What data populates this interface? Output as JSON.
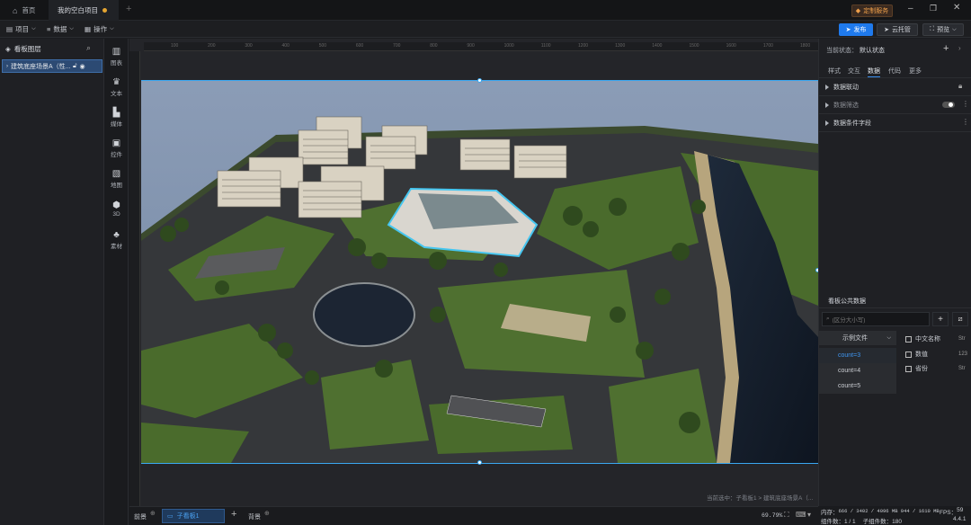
{
  "tabs": [
    {
      "label": "首页"
    },
    {
      "label": "我的空白项目"
    }
  ],
  "topRight": {
    "customize": "定制服务"
  },
  "menu": {
    "project": "项目",
    "data": "数据",
    "operate": "操作"
  },
  "actions": {
    "publish": "发布",
    "hosting": "云托管",
    "preview": "预览"
  },
  "layers": {
    "title": "看板图层",
    "items": [
      {
        "label": "建筑底座场景A（性..."
      }
    ]
  },
  "components": [
    {
      "label": "图表",
      "icon": "chart-icon"
    },
    {
      "label": "文本",
      "icon": "text-icon"
    },
    {
      "label": "媒体",
      "icon": "media-icon"
    },
    {
      "label": "控件",
      "icon": "control-icon"
    },
    {
      "label": "地图",
      "icon": "map-icon"
    },
    {
      "label": "3D",
      "icon": "3d-icon"
    },
    {
      "label": "素材",
      "icon": "material-icon"
    }
  ],
  "rightPanel": {
    "stateLabel": "当前状态：",
    "stateValue": "默认状态",
    "tabs": [
      "样式",
      "交互",
      "数据",
      "代码",
      "更多"
    ],
    "activeTab": "数据",
    "sections": [
      "数据联动",
      "数据筛选",
      "数据条件字段"
    ],
    "publicData": {
      "title": "看板公共数据",
      "searchPlaceholder": "(区分大小写)",
      "fileSelect": "示例文件",
      "counts": [
        "count=3",
        "count=4",
        "count=5"
      ],
      "fields": [
        {
          "name": "中文名称",
          "type": "Str"
        },
        {
          "name": "数值",
          "type": "123"
        },
        {
          "name": "省份",
          "type": "Str"
        }
      ]
    }
  },
  "rulerTicks": [
    "100",
    "200",
    "300",
    "400",
    "500",
    "600",
    "700",
    "800",
    "900",
    "1000",
    "1100",
    "1200",
    "1300",
    "1400",
    "1500",
    "1600",
    "1700",
    "1800"
  ],
  "canvasInfo": "当前选中：子看板1 > 建筑底座场景A（...",
  "bottom": {
    "first": "前景",
    "board": "子看板1",
    "back": "背景",
    "zoom": "69.79%"
  },
  "status": {
    "memoryLabel": "内存：",
    "memory": "666 / 3402 / 4096 MB  944 / 1610 MB",
    "fpsLabel": "FPS：",
    "fps": "59",
    "componentCount": "组件数：1 / 1",
    "subComponentCount": "子组件数：180",
    "version": "4.4.1"
  }
}
